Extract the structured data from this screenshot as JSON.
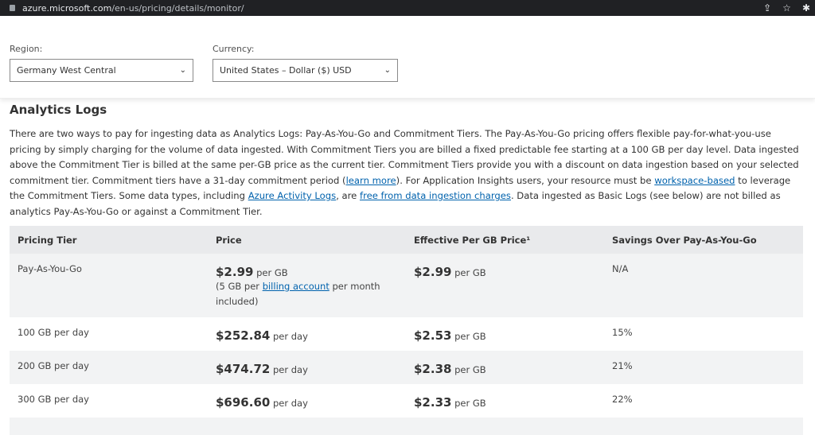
{
  "browser": {
    "url_host": "azure.microsoft.com",
    "url_path": "/en-us/pricing/details/monitor/"
  },
  "filters": {
    "region_label": "Region:",
    "region_value": "Germany West Central",
    "currency_label": "Currency:",
    "currency_value": "United States – Dollar ($) USD"
  },
  "section": {
    "title": "Analytics Logs",
    "p": [
      "There are two ways to pay for ingesting data as Analytics Logs: Pay-As-You-Go and Commitment Tiers. The Pay-As-You-Go pricing offers flexible pay-for-what-you-use pricing by simply charging for the volume of data ingested. With Commitment Tiers you are billed a fixed predictable fee starting at a 100 GB per day level. Data ingested above the Commitment Tier is billed at the same per-GB price as the current tier. Commitment Tiers provide you with a discount on data ingestion based on your selected commitment tier. Commitment tiers have a 31-day commitment period (",
      "learn more",
      "). For Application Insights users, your resource must be ",
      "workspace-based",
      " to leverage the Commitment Tiers. Some data types, including ",
      "Azure Activity Logs",
      ", are ",
      "free from data ingestion charges",
      ". Data ingested as Basic Logs (see below) are not billed as analytics Pay-As-You-Go or against a Commitment Tier."
    ]
  },
  "table": {
    "headers": [
      "Pricing Tier",
      "Price",
      "Effective Per GB Price¹",
      "Savings Over Pay-As-You-Go"
    ],
    "rows": [
      {
        "tier": "Pay-As-You-Go",
        "price": "$2.99",
        "price_unit": "per GB",
        "note_pre": "(5 GB per ",
        "note_link": "billing account",
        "note_post": " per month included)",
        "eff": "$2.99",
        "eff_unit": "per GB",
        "savings": "N/A"
      },
      {
        "tier": "100 GB per day",
        "price": "$252.84",
        "price_unit": "per day",
        "eff": "$2.53",
        "eff_unit": "per GB",
        "savings": "15%"
      },
      {
        "tier": "200 GB per day",
        "price": "$474.72",
        "price_unit": "per day",
        "eff": "$2.38",
        "eff_unit": "per GB",
        "savings": "21%"
      },
      {
        "tier": "300 GB per day",
        "price": "$696.60",
        "price_unit": "per day",
        "eff": "$2.33",
        "eff_unit": "per GB",
        "savings": "22%"
      }
    ]
  }
}
